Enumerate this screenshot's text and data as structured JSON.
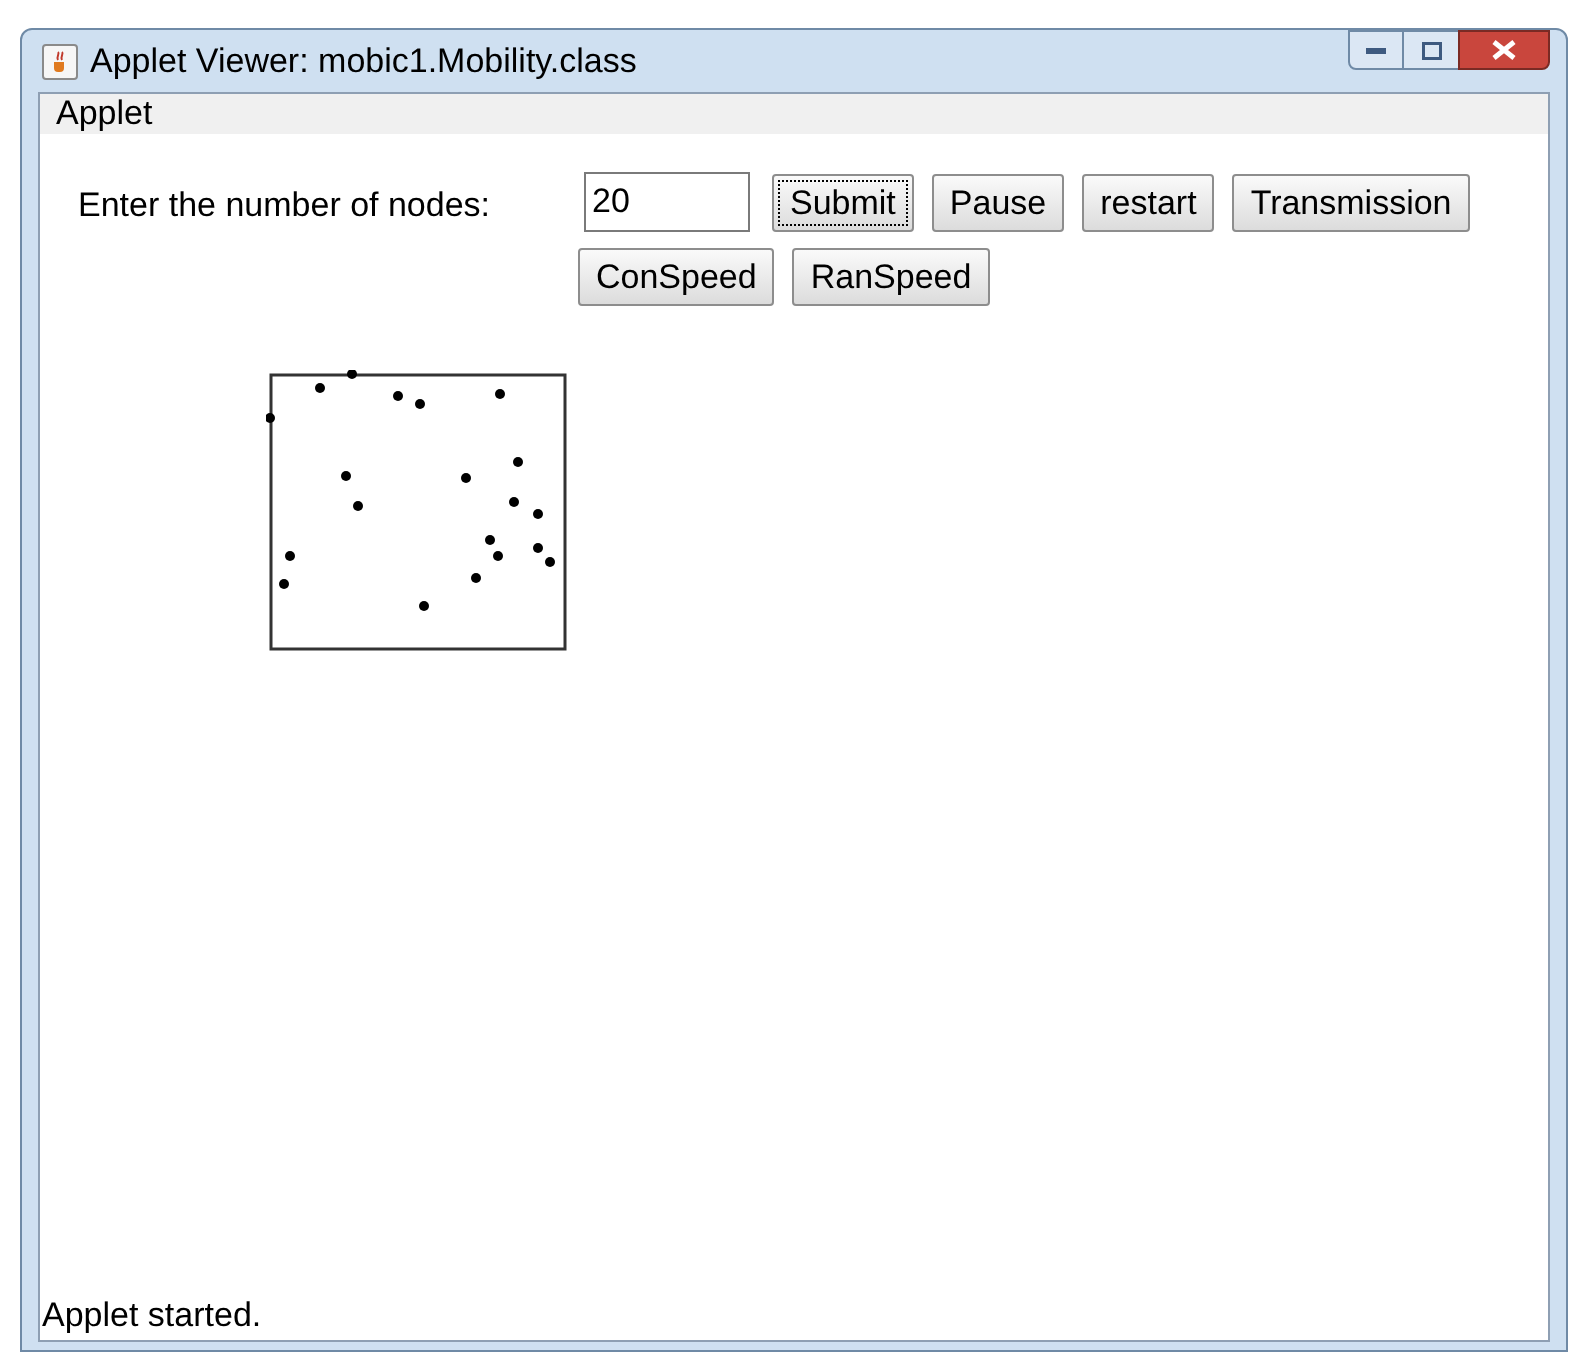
{
  "window": {
    "title": "Applet Viewer: mobic1.Mobility.class"
  },
  "menu_bar": {
    "items": [
      "Applet"
    ]
  },
  "form": {
    "label": "Enter the number of nodes:",
    "nodes_field": {
      "value": "20"
    },
    "buttons": [
      {
        "label": "Submit",
        "focused": true
      },
      {
        "label": "Pause",
        "focused": false
      },
      {
        "label": "restart",
        "focused": false
      },
      {
        "label": "Transmission",
        "focused": false
      },
      {
        "label": "ConSpeed",
        "focused": false
      },
      {
        "label": "RanSpeed",
        "focused": false
      }
    ]
  },
  "status_bar": {
    "text": "Applet started."
  }
}
